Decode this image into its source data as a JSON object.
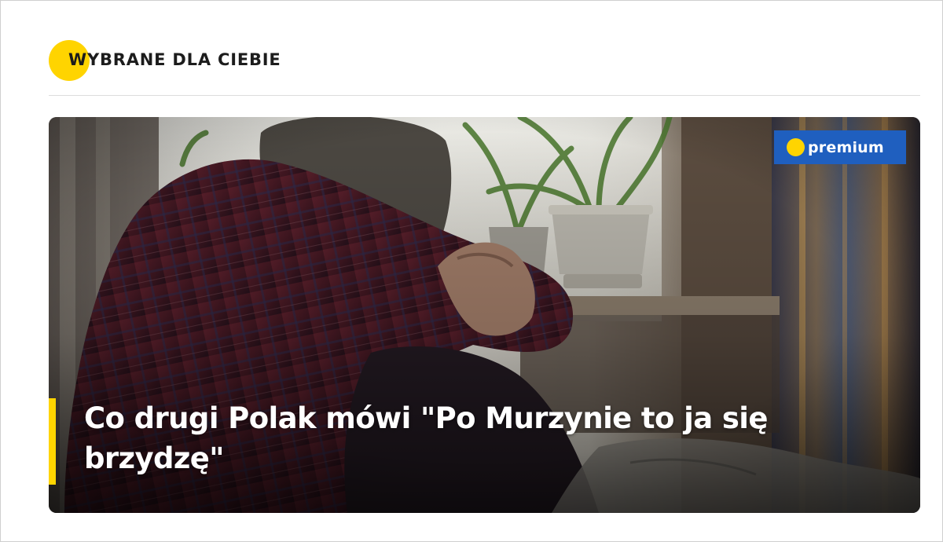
{
  "section": {
    "title": "WYBRANE DLA CIEBIE",
    "accent_color": "#ffd400"
  },
  "article": {
    "headline": "Co drugi Polak mówi \"Po Murzynie to ja się brzydzę\"",
    "badge": {
      "label": "premium",
      "background_color": "#1f5fbf",
      "dot_color": "#ffd400"
    },
    "image_subject": "person sitting hunched with arms around knees near a window with potted plants"
  }
}
